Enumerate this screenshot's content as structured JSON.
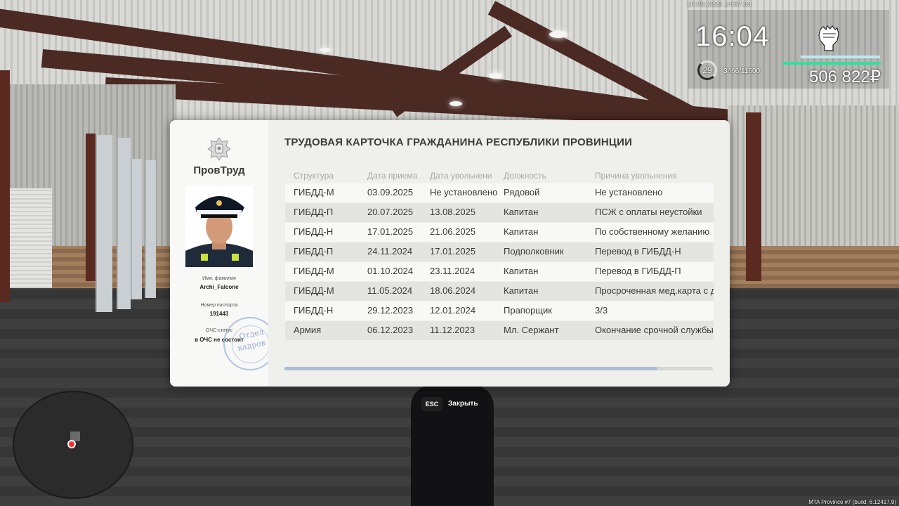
{
  "hud": {
    "datetime": "10.09.2025 14:57:33",
    "time": "16:04",
    "level": "29",
    "xp": "3466/11600",
    "money": "506 822₽",
    "fist_icon": "fist-icon",
    "health_fraction": 1.0,
    "armor_fraction": 1.0
  },
  "card": {
    "org_name": "ПровТруд",
    "title": "ТРУДОВАЯ КАРТОЧКА ГРАЖДАНИНА РЕСПУБЛИКИ ПРОВИНЦИИ",
    "name_label": "Имя, фамилия",
    "name_value": "Archi_Falcone",
    "passport_label": "Номер паспорта",
    "passport_value": "191443",
    "status_label": "ОЧС-статус",
    "status_value": "в ОЧС не состоит",
    "stamp_line1": "Отдел",
    "stamp_line2": "кадров",
    "columns": [
      "Структура",
      "Дата приема",
      "Дата увольнени",
      "Должность",
      "Причина увольнения"
    ],
    "rows": [
      [
        "ГИБДД-М",
        "03.09.2025",
        "Не установлено",
        "Рядовой",
        "Не установлено"
      ],
      [
        "ГИБДД-П",
        "20.07.2025",
        "13.08.2025",
        "Капитан",
        "ПСЖ с оплаты неустойки"
      ],
      [
        "ГИБДД-Н",
        "17.01.2025",
        "21.06.2025",
        "Капитан",
        "По собственному желанию"
      ],
      [
        "ГИБДД-П",
        "24.11.2024",
        "17.01.2025",
        "Подполковник",
        "Перевод в ГИБДД-Н"
      ],
      [
        "ГИБДД-М",
        "01.10.2024",
        "23.11.2024",
        "Капитан",
        "Перевод в ГИБДД-П"
      ],
      [
        "ГИБДД-М",
        "11.05.2024",
        "18.06.2024",
        "Капитан",
        "Просроченная мед.карта с д"
      ],
      [
        "ГИБДД-Н",
        "29.12.2023",
        "12.01.2024",
        "Прапорщик",
        "3/3"
      ],
      [
        "Армия",
        "06.12.2023",
        "11.12.2023",
        "Мл. Сержант",
        "Окончание срочной службы"
      ]
    ],
    "scroll_fraction": 0.87
  },
  "close": {
    "key": "ESC",
    "label": "Закрыть"
  },
  "build_info": "MTA Province #7 (build: 6.12417.9)"
}
